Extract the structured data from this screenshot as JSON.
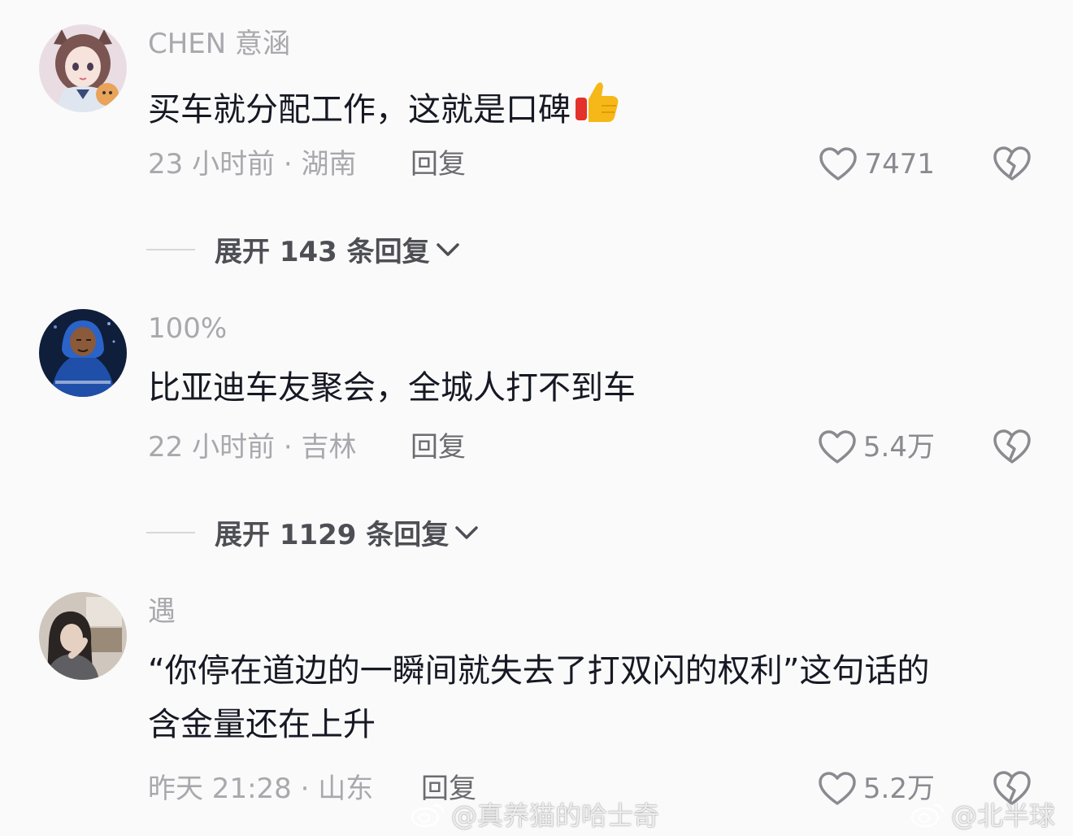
{
  "comments": [
    {
      "username": "CHEN 意涵",
      "text": "买车就分配工作，这就是口碑",
      "meta": "23 小时前 · 湖南",
      "reply_label": "回复",
      "likes": "7471",
      "expand_label": "展开 143 条回复"
    },
    {
      "username": "100%",
      "text": "比亚迪车友聚会，全城人打不到车",
      "meta": "22 小时前 · 吉林",
      "reply_label": "回复",
      "likes": "5.4万",
      "expand_label": "展开 1129 条回复"
    },
    {
      "username": "遇",
      "text_line1": "“你停在道边的一瞬间就失去了打双闪的权利”这句话的",
      "text_line2": "含金量还在上升",
      "meta": "昨天 21:28 · 山东",
      "reply_label": "回复",
      "likes": "5.2万"
    }
  ],
  "watermarks": {
    "left": "@真养猫的哈士奇",
    "right": "@北半球"
  },
  "colors": {
    "background": "#fafafa",
    "text_primary": "#161823",
    "text_secondary": "#a8a8ad"
  },
  "icons": {
    "like": "heart-outline-icon",
    "dislike": "broken-heart-icon",
    "expand": "chevron-down-icon",
    "emoji": "thumbs-up-icon"
  }
}
